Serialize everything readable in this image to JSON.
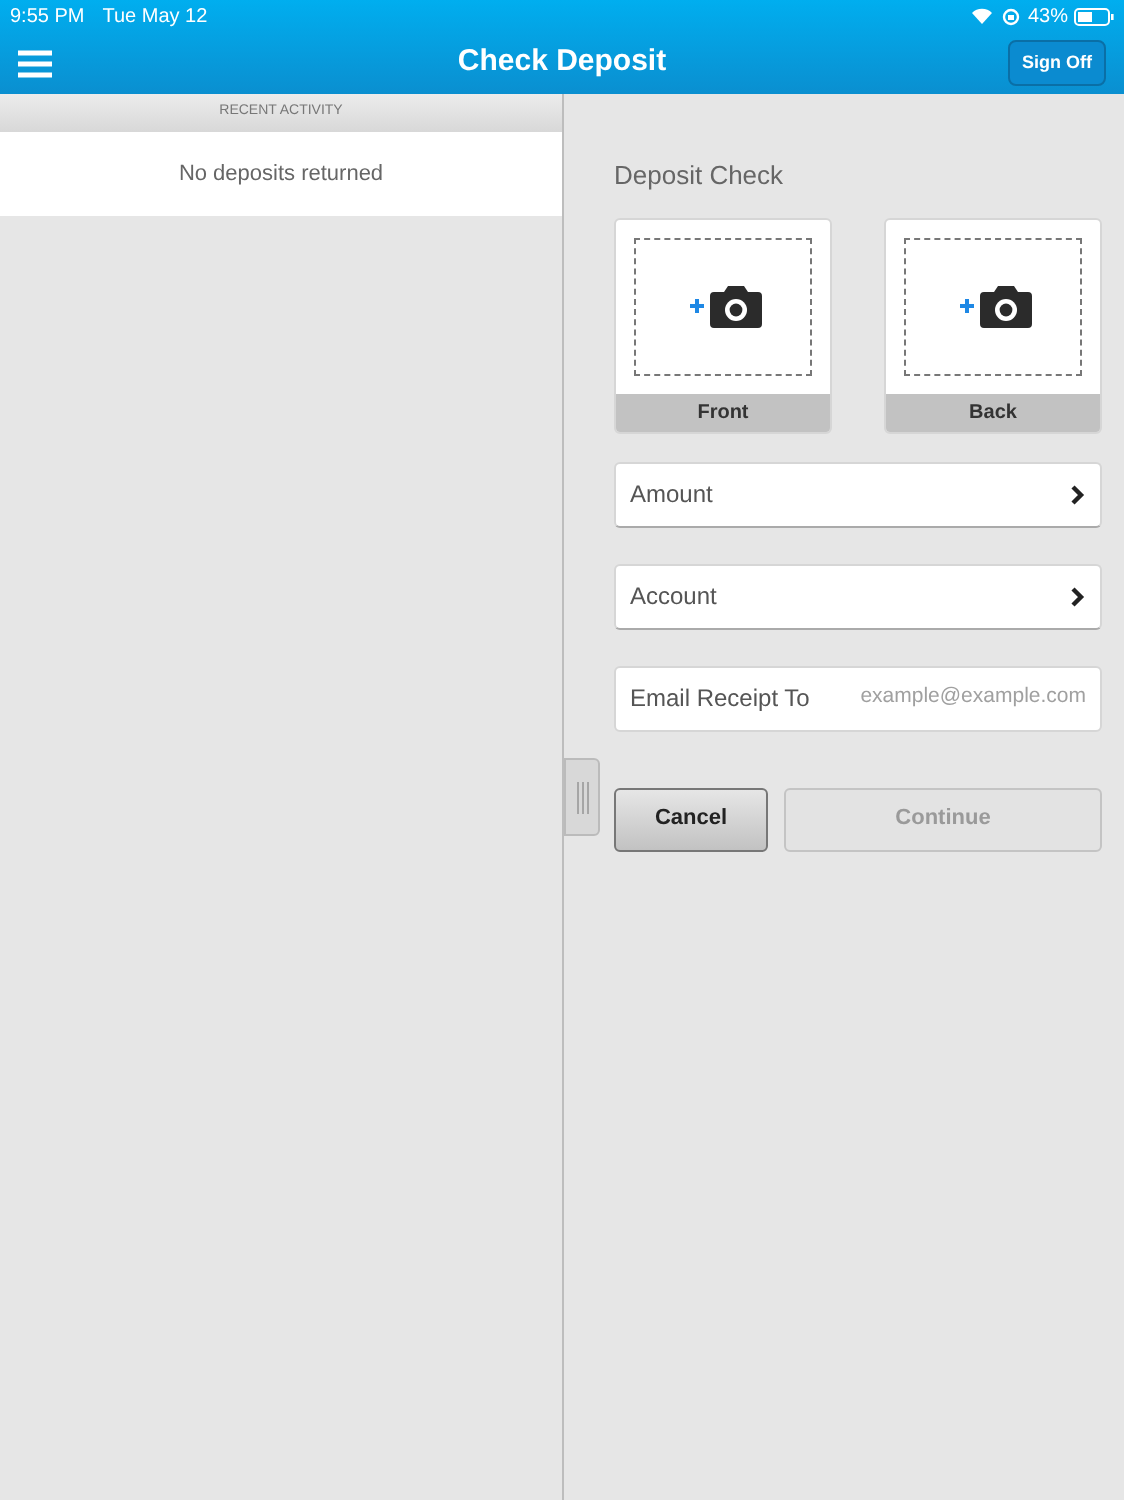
{
  "status_bar": {
    "time": "9:55 PM",
    "date": "Tue May 12",
    "battery": "43%"
  },
  "nav_bar": {
    "title": "Check Deposit",
    "sign_off": "Sign Off"
  },
  "recent_activity": {
    "header": "RECENT ACTIVITY",
    "empty_message": "No deposits returned"
  },
  "deposit_form": {
    "title": "Deposit Check",
    "captures": [
      {
        "label": "Front"
      },
      {
        "label": "Back"
      }
    ],
    "fields": [
      {
        "kind": "picker",
        "label": "Amount"
      },
      {
        "kind": "picker",
        "label": "Account"
      },
      {
        "kind": "input",
        "label": "Email Receipt To",
        "placeholder": "example@example.com"
      }
    ],
    "buttons": [
      {
        "label": "Cancel",
        "disabled": false
      },
      {
        "label": "Continue",
        "disabled": true
      }
    ]
  }
}
